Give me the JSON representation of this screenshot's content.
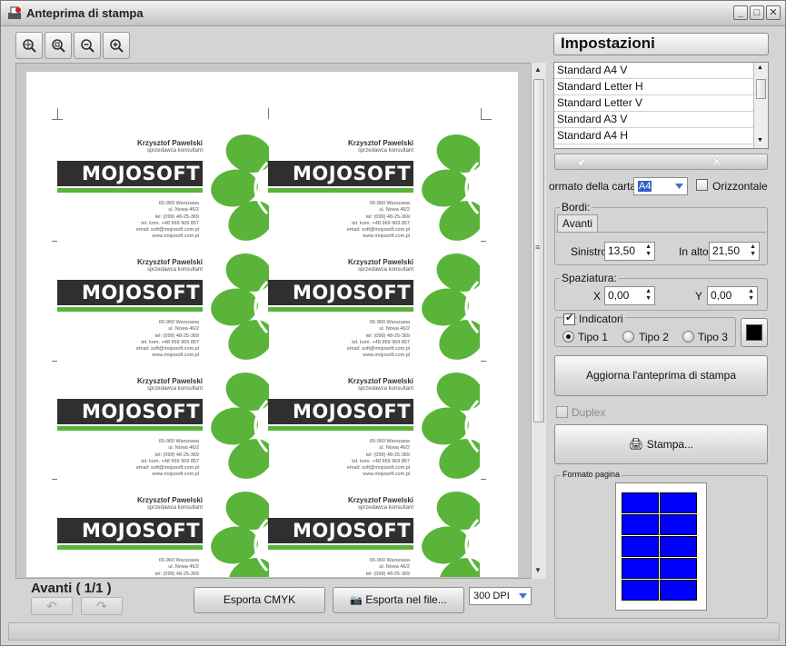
{
  "window": {
    "title": "Anteprima di stampa"
  },
  "toolbar": {
    "buttons": [
      "zoom-fit-icon",
      "zoom-page-icon",
      "zoom-out-icon",
      "zoom-in-icon"
    ]
  },
  "card": {
    "name": "Krzysztof Pawelski",
    "role": "sprzedawca konsultant",
    "brand": "MOJOSOFT",
    "address": [
      "65-960 Warszawa",
      "ul. Nowa 46/2",
      "tel: (099) 48-25-369",
      "tel. kom. +48 969 969 857",
      "email: soft@mojosoft.com.pl",
      "www.mojosoft.com.pl"
    ],
    "brand_green": "#5ab43a",
    "bar_color": "#2f2f2f"
  },
  "bottom": {
    "page_label": "Avanti ( 1/1 )",
    "export_cmyk": "Esporta CMYK",
    "export_file": "Esporta nel file...",
    "dpi": "300 DPI"
  },
  "settings": {
    "title": "Impostazioni",
    "formats": [
      "Standard A4 V",
      "Standard Letter H",
      "Standard Letter V",
      "Standard A3 V",
      "Standard A4 H"
    ],
    "paper_format_label": "ormato della carta",
    "paper_format_value": "A4",
    "landscape_label": "Orizzontale",
    "margins_label": "Bordi:",
    "margins_tab": "Avanti",
    "left_label": "Sinistro",
    "left_value": "13,50",
    "top_label": "In alto",
    "top_value": "21,50",
    "spacing_label": "Spaziatura:",
    "x_label": "X",
    "x_value": "0,00",
    "y_label": "Y",
    "y_value": "0,00",
    "indicators_label": "Indicatori",
    "type1": "Tipo 1",
    "type2": "Tipo 2",
    "type3": "Tipo 3",
    "refresh_button": "Aggiorna l'anteprima di stampa",
    "duplex_label": "Duplex",
    "print_button": "Stampa...",
    "page_format_label": "Formato pagina",
    "layout_color": "#0000ff"
  }
}
